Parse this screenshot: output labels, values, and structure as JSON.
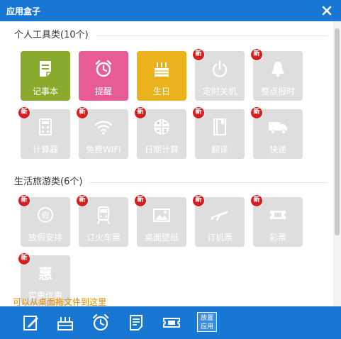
{
  "window": {
    "title": "应用盒子"
  },
  "sections": [
    {
      "title": "个人工具类(10个)"
    },
    {
      "title": "生活旅游类(6个)"
    }
  ],
  "personal_apps": [
    {
      "label": "记事本",
      "color": "#8aaa2d",
      "icon": "notepad-icon",
      "new": false,
      "enabled": true
    },
    {
      "label": "提醒",
      "color": "#e85c95",
      "icon": "alarm-icon",
      "new": false,
      "enabled": true
    },
    {
      "label": "生日",
      "color": "#eab21c",
      "icon": "cake-icon",
      "new": false,
      "enabled": true
    },
    {
      "label": "定时关机",
      "icon": "power-icon",
      "new": true,
      "enabled": false
    },
    {
      "label": "整点报时",
      "icon": "bell-icon",
      "new": true,
      "enabled": false
    },
    {
      "label": "计算器",
      "icon": "calculator-icon",
      "new": true,
      "enabled": false
    },
    {
      "label": "免费WIFI",
      "icon": "wifi-icon",
      "new": true,
      "enabled": false
    },
    {
      "label": "日期计算",
      "icon": "date-calc-icon",
      "new": true,
      "enabled": false
    },
    {
      "label": "翻译",
      "icon": "book-icon",
      "new": true,
      "enabled": false
    },
    {
      "label": "快递",
      "icon": "truck-icon",
      "new": true,
      "enabled": false
    }
  ],
  "travel_apps": [
    {
      "label": "放假安排",
      "icon": "holiday-icon",
      "new": true,
      "enabled": false
    },
    {
      "label": "订火车票",
      "icon": "train-icon",
      "new": true,
      "enabled": false
    },
    {
      "label": "桌面壁纸",
      "icon": "wallpaper-icon",
      "new": true,
      "enabled": false
    },
    {
      "label": "订机票",
      "icon": "plane-icon",
      "new": true,
      "enabled": false
    },
    {
      "label": "彩票",
      "icon": "lottery-icon",
      "new": true,
      "enabled": false
    },
    {
      "label": "实惠优惠",
      "icon": "discount-icon",
      "new": true,
      "enabled": false
    }
  ],
  "badge_text": "新",
  "hint": "可以从桌面拖文件到这里",
  "dock": {
    "items": [
      "notepad-icon",
      "cake-icon",
      "alarm-icon",
      "document-icon",
      "lottery-icon"
    ],
    "place_app_label": "放置应用"
  },
  "colors": {
    "titlebar": "#1877d2",
    "disabled_tile": "#dedede",
    "badge": "#d81e1e",
    "hint": "#e08a00"
  }
}
